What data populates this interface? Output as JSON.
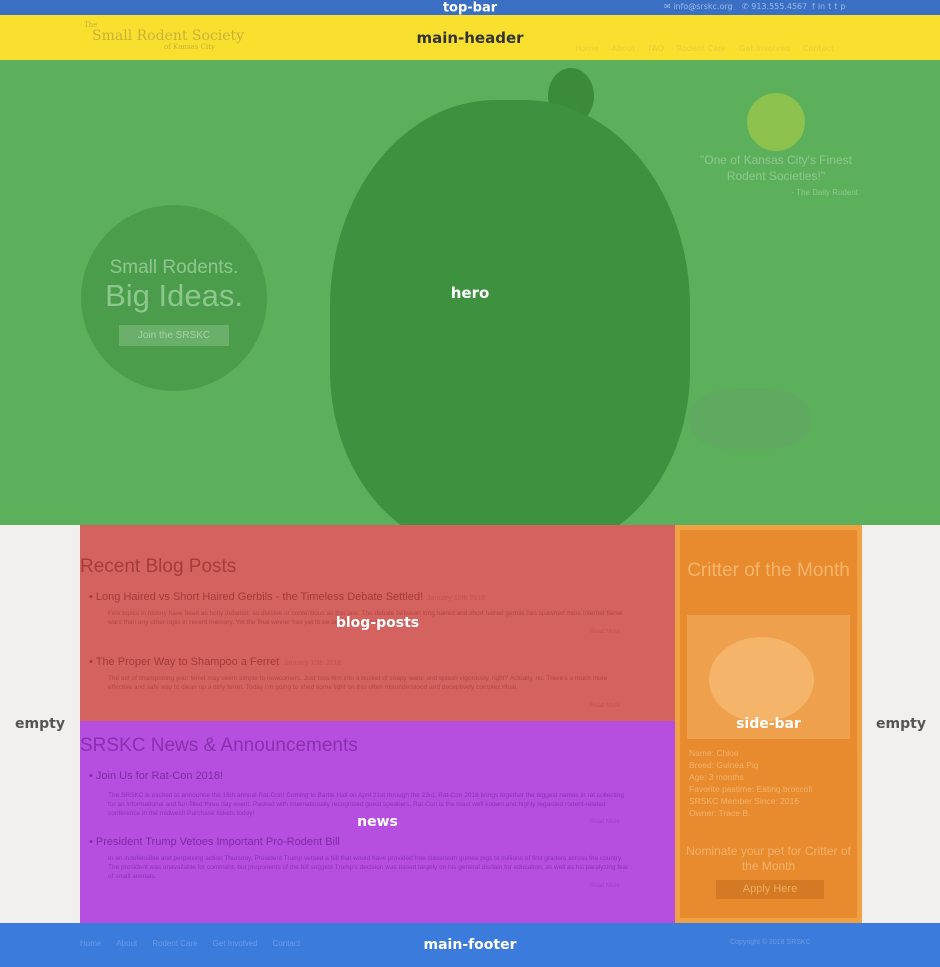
{
  "regions": {
    "top_bar": "top-bar",
    "main_header": "main-header",
    "hero": "hero",
    "empty_left": "empty",
    "empty_right": "empty",
    "blog_posts": "blog-posts",
    "news": "news",
    "side_bar": "side-bar",
    "main_footer": "main-footer"
  },
  "top_bar": {
    "email": "info@srskc.org",
    "phone": "913.555.4567",
    "social_icons": [
      "facebook-icon",
      "linkedin-icon",
      "twitter-icon",
      "tumblr-icon",
      "pinterest-icon"
    ],
    "social_glyphs": [
      "f",
      "in",
      "t",
      "t",
      "p"
    ]
  },
  "header": {
    "logo_line1": "The",
    "logo_line2": "Small Rodent Society",
    "logo_line3": "of Kansas City",
    "nav": [
      "Home",
      "About",
      "FAQ",
      "Rodent Care",
      "Get Involved",
      "Contact"
    ]
  },
  "hero": {
    "circle_line1": "Small Rodents.",
    "circle_line2": "Big Ideas.",
    "join_button": "Join the SRSKC",
    "quote": "\"One of Kansas City's Finest Rodent Societies!\"",
    "quote_attribution": "- The Daily Rodent"
  },
  "blog": {
    "title": "Recent Blog Posts",
    "read_more": "Read More",
    "posts": [
      {
        "title": "Long Haired vs Short Haired Gerbils - the Timeless Debate Settled!",
        "date": "January 10th 2018",
        "excerpt": "Few topics in history have been as hotly debated, as divisive or contentious as this one. The debate between long haired and short haired gerbils has spawned more internet flame wars than any other topic in recent memory. Yet the final winner has yet to be determined. Until now."
      },
      {
        "title": "The Proper Way to Shampoo a Ferret",
        "date": "January 10th 2018",
        "excerpt": "The act of shampooing your ferret may seem simple to newcomers. Just toss him into a bucket of soapy water and splash vigorously, right? Actually, no. There's a much more effective and safe way to clean up a dirty ferret. Today I'm going to shed some light on this often misunderstood and deceptively complex ritual."
      }
    ]
  },
  "news": {
    "title": "SRSKC News & Announcements",
    "read_more": "Read More",
    "items": [
      {
        "title": "Join Us for Rat-Con 2018!",
        "excerpt": "The SRSKC is excited to announce the 16th annual Rat-Con! Coming to Bartle Hall on April 21st through the 23rd, Rat-Con 2018 brings together the biggest names in rat collecting for an informational and fun-filled three day event. Packed with internationally recognized guest speakers, Rat-Con is the most well known and highly regarded rodent-related conference in the midwest! Purchase tickets today!"
      },
      {
        "title": "President Trump Vetoes Important Pro-Rodent Bill",
        "excerpt": "In an indefensible and perplexing action Thursday, President Trump vetoed a bill that would have provided free classroom guinea pigs to millions of first graders across the country. The president was unavailable for comment, but proponents of the bill suggest Trump's decision was based largely on his general disdain for education, as well as his paralyzing fear of small animals."
      }
    ]
  },
  "sidebar": {
    "title": "Critter of the Month",
    "pet_info": [
      "Name: Chloe",
      "Breed: Guinea Pig",
      "Age: 3 months",
      "Favorite pastime: Eating broccoli",
      "SRSKC Member Since: 2016",
      "Owner: Trace B."
    ],
    "nominate": "Nominate your pet for Critter of the Month",
    "apply_button": "Apply Here"
  },
  "footer": {
    "nav": [
      "Home",
      "About",
      "Rodent Care",
      "Get Involved",
      "Contact"
    ],
    "copyright": "Copyright © 2018 SRSKC"
  },
  "colors": {
    "top_bar": "#3a6fc4",
    "main_header": "#f9e02e",
    "hero": "#5cb05c",
    "empty": "#f2f0ee",
    "blog_posts": "#d4625f",
    "news": "#b64ee0",
    "side_bar": "#e88a2e",
    "main_footer": "#3b7bdb"
  }
}
